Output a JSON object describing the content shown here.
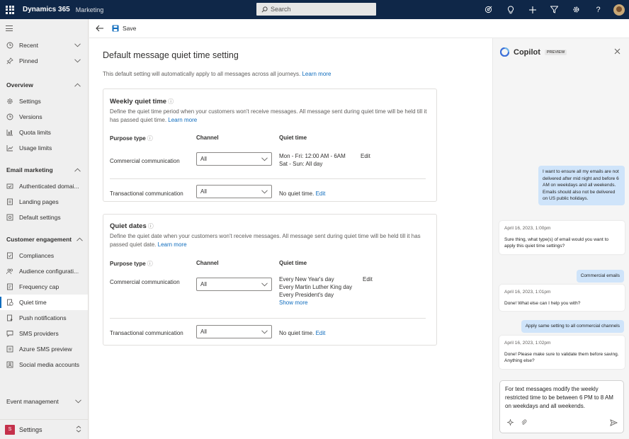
{
  "topbar": {
    "brand": "Dynamics 365",
    "module": "Marketing",
    "search_placeholder": "Search",
    "icons": [
      "waffle-icon",
      "search-icon",
      "target-icon",
      "lightbulb-icon",
      "plus-icon",
      "filter-icon",
      "gear-icon",
      "help-icon",
      "avatar"
    ]
  },
  "commandbar": {
    "save_label": "Save"
  },
  "sidebar": {
    "recent": "Recent",
    "pinned": "Pinned",
    "overview": {
      "title": "Overview",
      "items": [
        "Settings",
        "Versions",
        "Quota limits",
        "Usage limits"
      ]
    },
    "email_marketing": {
      "title": "Email marketing",
      "items": [
        "Authenticated domai...",
        "Landing pages",
        "Default settings"
      ]
    },
    "customer_engagement": {
      "title": "Customer engagement",
      "items": [
        "Compliances",
        "Audience configurati...",
        "Frequency cap",
        "Quiet time",
        "Push notifications",
        "SMS providers",
        "Azure SMS preview",
        "Social media accounts"
      ]
    },
    "event_management": "Event management",
    "area": {
      "badge": "S",
      "label": "Settings"
    }
  },
  "main": {
    "title": "Default message quiet time setting",
    "description": "This default setting will automatically apply to all messages across all journeys.",
    "learn_more": "Learn more",
    "weekly": {
      "title": "Weekly quiet time",
      "description": "Define the quiet time period when your customers won't receive messages. All message sent during quiet time will be held till it has passed quiet time.",
      "learn_more": "Learn more",
      "col_purpose": "Purpose type",
      "col_channel": "Channel",
      "col_quiet": "Quiet time",
      "rows": [
        {
          "purpose": "Commercial communication",
          "channel": "All",
          "quiet_line1": "Mon - Fri: 12:00 AM - 6AM",
          "quiet_line2": "Sat - Sun: All day",
          "edit": "Edit"
        },
        {
          "purpose": "Transactional communication",
          "channel": "All",
          "quiet_line1": "No quiet time.",
          "edit": "Edit"
        }
      ]
    },
    "dates": {
      "title": "Quiet dates",
      "description": "Define the quiet date when your customers won't receive messages. All message sent during quiet time will be held till it has passed quiet date.",
      "learn_more": "Learn more",
      "col_purpose": "Purpose type",
      "col_channel": "Channel",
      "col_quiet": "Quiet time",
      "rows": [
        {
          "purpose": "Commercial communication",
          "channel": "All",
          "dates": [
            "Every New Year's day",
            "Every Martin Luther King day",
            "Every President's day"
          ],
          "show_more": "Show more",
          "edit": "Edit"
        },
        {
          "purpose": "Transactional communication",
          "channel": "All",
          "quiet_line1": "No quiet time.",
          "edit": "Edit"
        }
      ]
    }
  },
  "copilot": {
    "title": "Copilot",
    "badge": "PREVIEW",
    "messages": [
      {
        "role": "user",
        "text": "I want to ensure all my emails are not delivered after mid night and before 6 AM on weekdays and all weekends. Emails should also not be delivered on US public holidays."
      },
      {
        "role": "bot",
        "time": "April 16, 2023, 1:00pm",
        "text": "Sure thing, what type(s) of email would you want to apply this quiet time settings?"
      },
      {
        "role": "user",
        "text": "Commercial emails"
      },
      {
        "role": "bot",
        "time": "April 16, 2023, 1:01pm",
        "text": "Done! What else can I help you with?"
      },
      {
        "role": "user",
        "text": "Apply same setting to all commercial channels"
      },
      {
        "role": "bot",
        "time": "April 16, 2023, 1:02pm",
        "text": "Done! Please make sure to validate them before saving. Anything else?"
      }
    ],
    "compose_text": "For text messages modify the weekly restricted time to be between 6 PM to 8 AM on weekdays and all weekends."
  }
}
